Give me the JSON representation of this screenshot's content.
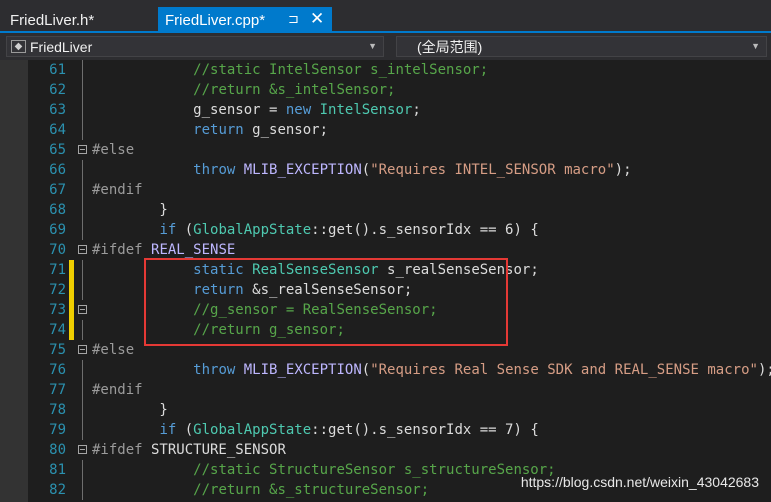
{
  "tabs": {
    "inactive_label": "FriedLiver.h*",
    "active_label": "FriedLiver.cpp*",
    "pin_glyph": "⊐",
    "close_glyph": "✕"
  },
  "nav": {
    "left_combo": "FriedLiver",
    "right_combo": "(全局范围)"
  },
  "colors": {
    "accent": "#007acc",
    "change_marker": "#efce00",
    "highlight_box": "#e53935",
    "comment": "#57a64a",
    "keyword": "#569cd6",
    "type": "#4ec9b0",
    "string": "#d69d85",
    "macro": "#beb7ff",
    "line_number": "#2b91af"
  },
  "lines": [
    {
      "n": "61",
      "code": "            //static IntelSensor s_intelSensor;",
      "changed": false,
      "fold": false
    },
    {
      "n": "62",
      "code": "            //return &s_intelSensor;",
      "changed": false,
      "fold": false
    },
    {
      "n": "63",
      "code": "            g_sensor = new IntelSensor;",
      "changed": false,
      "fold": false
    },
    {
      "n": "64",
      "code": "            return g_sensor;",
      "changed": false,
      "fold": false
    },
    {
      "n": "65",
      "code": "#else",
      "changed": false,
      "fold": true
    },
    {
      "n": "66",
      "code": "            throw MLIB_EXCEPTION(\"Requires INTEL_SENSOR macro\");",
      "changed": false,
      "fold": false
    },
    {
      "n": "67",
      "code": "#endif",
      "changed": false,
      "fold": false
    },
    {
      "n": "68",
      "code": "        }",
      "changed": false,
      "fold": false
    },
    {
      "n": "69",
      "code": "        if (GlobalAppState::get().s_sensorIdx == 6) {",
      "changed": false,
      "fold": false
    },
    {
      "n": "70",
      "code": "#ifdef REAL_SENSE",
      "changed": false,
      "fold": true
    },
    {
      "n": "71",
      "code": "            static RealSenseSensor s_realSenseSensor;",
      "changed": true,
      "fold": false
    },
    {
      "n": "72",
      "code": "            return &s_realSenseSensor;",
      "changed": true,
      "fold": false
    },
    {
      "n": "73",
      "code": "            //g_sensor = RealSenseSensor;",
      "changed": true,
      "fold": true
    },
    {
      "n": "74",
      "code": "            //return g_sensor;",
      "changed": true,
      "fold": false
    },
    {
      "n": "75",
      "code": "#else",
      "changed": false,
      "fold": true
    },
    {
      "n": "76",
      "code": "            throw MLIB_EXCEPTION(\"Requires Real Sense SDK and REAL_SENSE macro\");",
      "changed": false,
      "fold": false
    },
    {
      "n": "77",
      "code": "#endif",
      "changed": false,
      "fold": false
    },
    {
      "n": "78",
      "code": "        }",
      "changed": false,
      "fold": false
    },
    {
      "n": "79",
      "code": "        if (GlobalAppState::get().s_sensorIdx == 7) {",
      "changed": false,
      "fold": false
    },
    {
      "n": "80",
      "code": "#ifdef STRUCTURE_SENSOR",
      "changed": false,
      "fold": true
    },
    {
      "n": "81",
      "code": "            //static StructureSensor s_structureSensor;",
      "changed": false,
      "fold": false
    },
    {
      "n": "82",
      "code": "            //return &s_structureSensor;",
      "changed": false,
      "fold": false
    }
  ],
  "watermark": "https://blog.csdn.net/weixin_43042683"
}
